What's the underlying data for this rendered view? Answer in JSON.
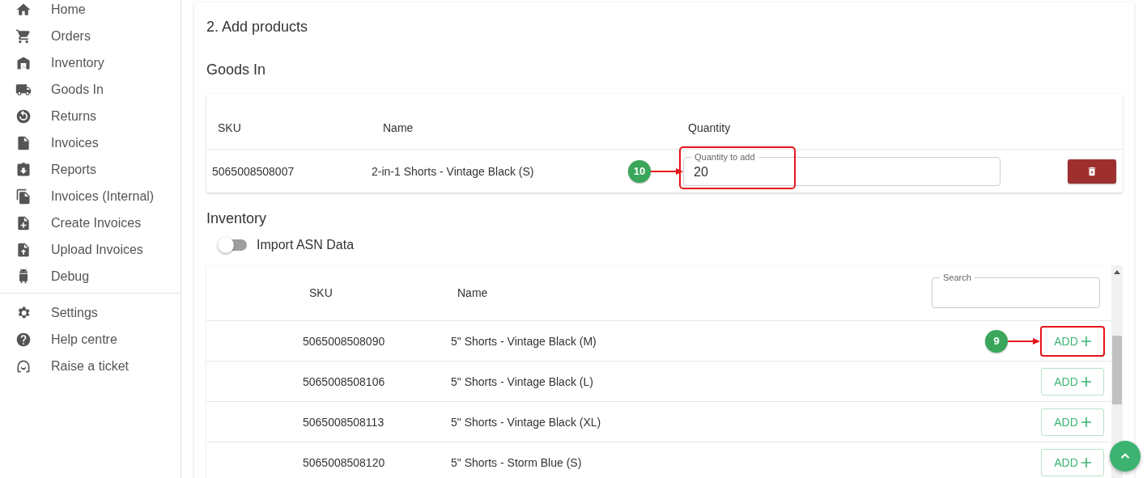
{
  "sidebar": {
    "items": [
      {
        "label": "Home"
      },
      {
        "label": "Orders"
      },
      {
        "label": "Inventory"
      },
      {
        "label": "Goods In"
      },
      {
        "label": "Returns"
      },
      {
        "label": "Invoices"
      },
      {
        "label": "Reports"
      },
      {
        "label": "Invoices (Internal)"
      },
      {
        "label": "Create Invoices"
      },
      {
        "label": "Upload Invoices"
      },
      {
        "label": "Debug"
      }
    ],
    "secondary_items": [
      {
        "label": "Settings"
      },
      {
        "label": "Help centre"
      },
      {
        "label": "Raise a ticket"
      }
    ]
  },
  "section_title": "2. Add products",
  "goods_in": {
    "title": "Goods In",
    "columns": [
      "SKU",
      "Name",
      "Quantity"
    ],
    "rows": [
      {
        "sku": "5065008508007",
        "name": "2-in-1 Shorts - Vintage Black (S)",
        "quantity": {
          "label": "Quantity to add",
          "value": "20"
        },
        "callout": {
          "step": "10"
        }
      }
    ]
  },
  "inventory": {
    "title": "Inventory",
    "toggle": {
      "label": "Import ASN Data",
      "on": false
    },
    "columns": [
      "SKU",
      "Name"
    ],
    "search": {
      "label": "Search"
    },
    "rows": [
      {
        "sku": "5065008508090",
        "name": "5\" Shorts - Vintage Black (M)",
        "action": "ADD",
        "callout": {
          "step": "9"
        }
      },
      {
        "sku": "5065008508106",
        "name": "5\" Shorts - Vintage Black (L)",
        "action": "ADD"
      },
      {
        "sku": "5065008508113",
        "name": "5\" Shorts - Vintage Black (XL)",
        "action": "ADD"
      },
      {
        "sku": "5065008508120",
        "name": "5\" Shorts - Storm Blue (S)",
        "action": "ADD"
      }
    ]
  }
}
